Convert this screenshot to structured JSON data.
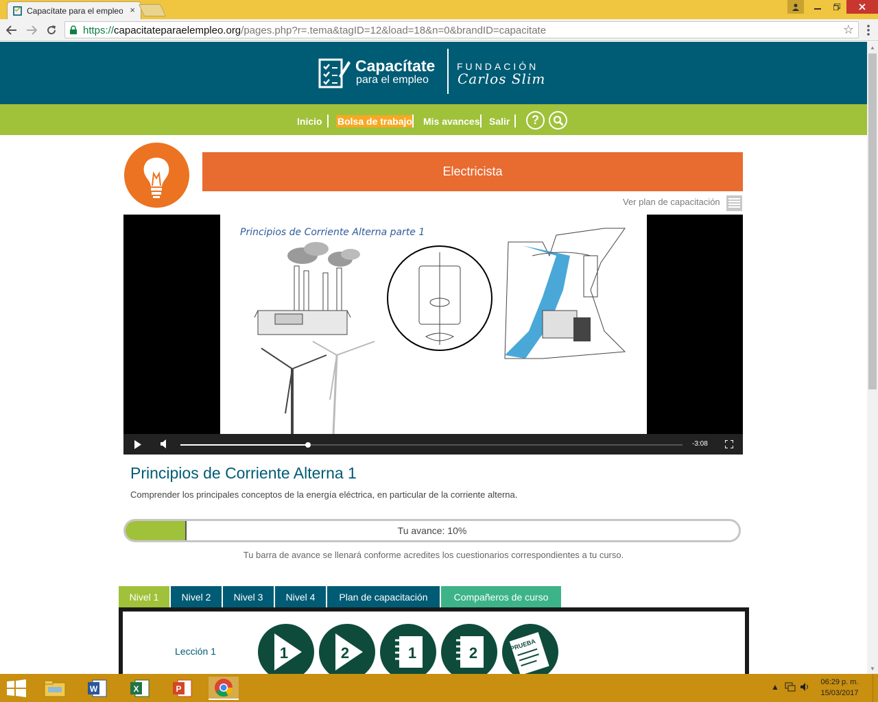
{
  "browser": {
    "tab_title": "Capacítate para el empleo",
    "tab_close": "×",
    "url_scheme": "https://",
    "url_host": "capacitateparaelempleo.org",
    "url_path": "/pages.php?r=.tema&tagID=12&load=18&n=0&brandID=capacitate",
    "back_icon": "arrow-left",
    "forward_icon": "arrow-right",
    "reload_icon": "reload",
    "bookmark_icon": "star"
  },
  "header": {
    "brand_main": "Capacítate",
    "brand_sub": "para el empleo",
    "foundation": "FUNDACIÓN",
    "foundation_name": "Carlos Slim",
    "bg_color": "#005b74"
  },
  "nav": {
    "items": [
      "Inicio",
      "Bolsa de trabajo",
      "Mis avances",
      "Salir"
    ],
    "active": "Bolsa de trabajo",
    "help_icon": "?",
    "search_icon": "search",
    "bg_color": "#a0c13a"
  },
  "course": {
    "title": "Electricista",
    "icon": "lightbulb-icon",
    "plan_link": "Ver plan de capacitación",
    "accent": "#e86b30"
  },
  "video": {
    "caption": "Principios de Corriente Alterna parte 1",
    "time_remaining": "-3:08",
    "played_fraction": 0.254
  },
  "lesson": {
    "title": "Principios de Corriente Alterna 1",
    "description": "Comprender los principales conceptos de la energía eléctrica, en particular de la corriente alterna."
  },
  "progress": {
    "label": "Tu avance: 10%",
    "percent": 10,
    "note": "Tu barra de avance se llenará conforme acredites los cuestionarios correspondientes a tu curso."
  },
  "tabs": [
    {
      "label": "Nivel 1",
      "style": "green"
    },
    {
      "label": "Nivel 2",
      "style": "teal"
    },
    {
      "label": "Nivel 3",
      "style": "teal"
    },
    {
      "label": "Nivel 4",
      "style": "teal"
    },
    {
      "label": "Plan de capacitación",
      "style": "teal"
    },
    {
      "label": "Compañeros de curso",
      "style": "mint"
    }
  ],
  "lesson_panel": {
    "label": "Lección 1",
    "buttons": [
      {
        "kind": "video",
        "number": "1"
      },
      {
        "kind": "video",
        "number": "2"
      },
      {
        "kind": "notebook",
        "number": "1"
      },
      {
        "kind": "notebook",
        "number": "2"
      },
      {
        "kind": "quiz",
        "text": "PRUEBA"
      }
    ]
  },
  "taskbar": {
    "apps": [
      "file-explorer-icon",
      "word-icon",
      "excel-icon",
      "powerpoint-icon",
      "chrome-icon"
    ],
    "active_app": "chrome-icon",
    "time": "06:29 p. m.",
    "date": "15/03/2017",
    "bg_color": "#c88f10"
  }
}
